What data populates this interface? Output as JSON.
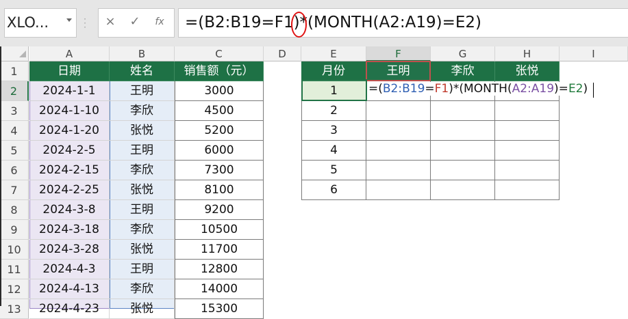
{
  "formula_bar": {
    "name_box": "XLO...",
    "cancel_icon": "×",
    "enter_icon": "✓",
    "function_icon": "fx",
    "formula": "=(B2:B19=F1)*(MONTH(A2:A19)=E2)"
  },
  "columns": [
    "A",
    "B",
    "C",
    "D",
    "E",
    "F",
    "G",
    "H",
    "I"
  ],
  "rows": [
    "1",
    "2",
    "3",
    "4",
    "5",
    "6",
    "7",
    "8",
    "9",
    "10",
    "11",
    "12",
    "13"
  ],
  "table1": {
    "headers": [
      "日期",
      "姓名",
      "销售额（元）"
    ],
    "rows": [
      [
        "2024-1-1",
        "王明",
        "3000"
      ],
      [
        "2024-1-10",
        "李欣",
        "4500"
      ],
      [
        "2024-1-20",
        "张悦",
        "5200"
      ],
      [
        "2024-2-5",
        "王明",
        "6000"
      ],
      [
        "2024-2-15",
        "李欣",
        "7300"
      ],
      [
        "2024-2-25",
        "张悦",
        "8100"
      ],
      [
        "2024-3-8",
        "王明",
        "9200"
      ],
      [
        "2024-3-18",
        "李欣",
        "10500"
      ],
      [
        "2024-3-28",
        "张悦",
        "11700"
      ],
      [
        "2024-4-3",
        "王明",
        "12800"
      ],
      [
        "2024-4-13",
        "李欣",
        "14000"
      ],
      [
        "2024-4-23",
        "张悦",
        "15300"
      ]
    ]
  },
  "table2": {
    "headers": [
      "月份",
      "王明",
      "李欣",
      "张悦"
    ],
    "months": [
      "1",
      "2",
      "3",
      "4",
      "5",
      "6"
    ]
  },
  "in_cell_edit": {
    "p1": "=(",
    "ref1": "B2:B19",
    "p2": "=",
    "ref2": "F1",
    "p3": ")*(MONTH(",
    "ref3": "A2:A19",
    "p4": ")=",
    "ref4": "E2",
    "p5": ")"
  },
  "colors": {
    "header_green": "#1e7145",
    "ref_blue": "#2f5fb3",
    "ref_red": "#c0392b",
    "ref_purple": "#7a4fa3",
    "ref_green": "#1f7a3a",
    "annotation_red": "#e01010"
  }
}
